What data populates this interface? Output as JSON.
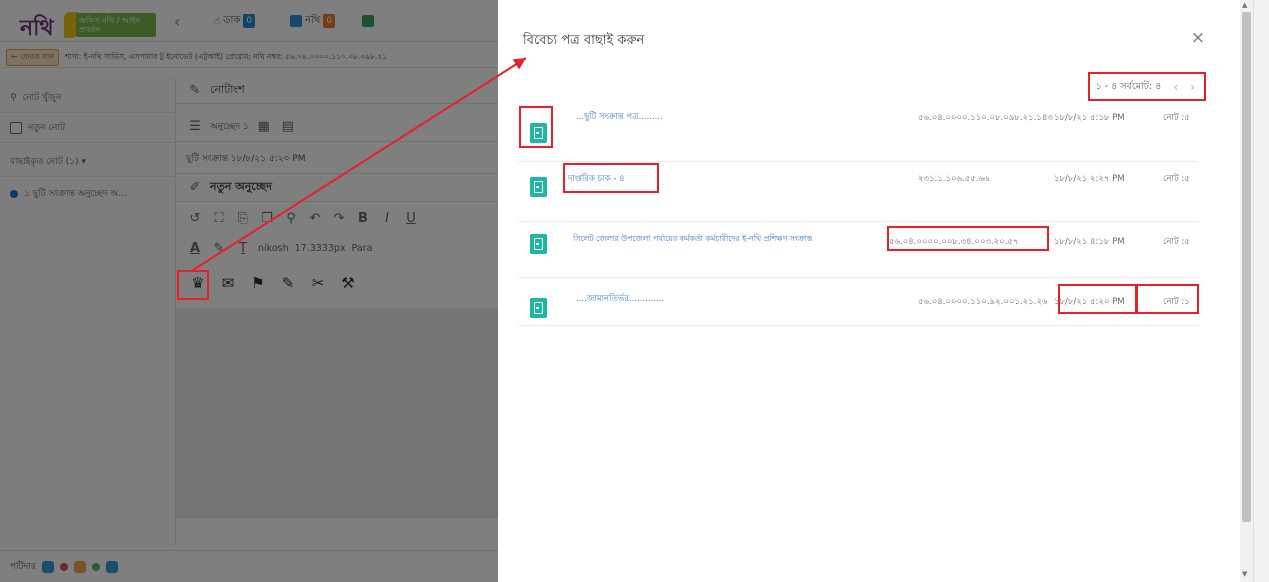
{
  "topbar": {
    "logo_text": "নথি",
    "logo_badge": "অফিস নথি / আইন প্রবর্তন",
    "back_arrow": "‹",
    "tab1_label": "ডাক",
    "tab2_label": "নথি"
  },
  "infobar": {
    "back_label": "← ফেরত যান",
    "info_text": "শাখা: ই-নথি সার্ভিস, এসপায়ার টু ইনোভেট (এটুআই) প্রোগ্রাম; নথি নম্বর: ৫৬.০৪.০০০০.১১০.০৮.০৯৮.২১"
  },
  "sidebar": {
    "search_label": "নোট খুঁজুন",
    "new_note_label": "নতুন নোট",
    "notes_header": "বাছাইকৃত নোট (১) ▾",
    "note_item": "১  ছুটি সংক্রান্ত অনুচ্ছেদ অ..."
  },
  "editor": {
    "note_title": "নোটাংশ",
    "note_meta": "অনুচ্ছেদ ১",
    "note_subject": "ছুটি সংক্রান্ত ১৮/৮/২১ ৫:২০ PM",
    "new_para_title": "নতুন অনুচ্ছেদ",
    "font_name": "nikosh",
    "font_size": "17.3333px",
    "paragraph": "Para",
    "bold": "B",
    "italic": "I",
    "underline": "U",
    "color_a": "A"
  },
  "statusbar": {
    "label": "পটিদার"
  },
  "modal": {
    "title": "বিবেচ্য পত্র বাছাই করুন",
    "close": "×",
    "pager_text": "১ - ৪ সর্বমোট: ৪",
    "prev": "‹",
    "next": "›",
    "rows": [
      {
        "subject": "...ছুটি সংক্রান্ত পত্র.........",
        "memo": "৫৬.০৪.০০০০.১১০.০৮.০৯৮.২১.১৪৩",
        "date": "১৮/৮/২১ ৫:১৮ PM",
        "note": "নোট :৫"
      },
      {
        "subject": "দাপ্তরিক চাক - ৪",
        "memo": "২৩১.১.১০৬.৫৫.৬৬",
        "date": "১৮/৮/২১ ২:২৭ PM",
        "note": "নোট :৫"
      },
      {
        "subject": "সিলেট জেলার উপজেলা পর্যায়ের কর্মকর্তা কর্মচারীদের ই-নথি প্রশিক্ষণ সংক্রান্ত",
        "memo": "৫৬.০৪.০০০০.০০৮.৩৪.০০৩.২০.৫৭",
        "date": "১৮/৮/২১ ৪:১৮ PM",
        "note": "নোট :৫"
      },
      {
        "subject": "....জামানতির্ভর.............",
        "memo": "৫৬.০৪.০০০০.১১০.৯২.০০১.২১.২৬",
        "date": "১৮/৮/২১ ৫:২০ PM",
        "note": "নোট :১"
      }
    ]
  },
  "colors": {
    "accent_red": "#e8202a",
    "doc_icon_teal": "#1fb6a5",
    "link_blue": "#3a7bd5",
    "overlay": "rgba(0,0,0,0.5)"
  }
}
